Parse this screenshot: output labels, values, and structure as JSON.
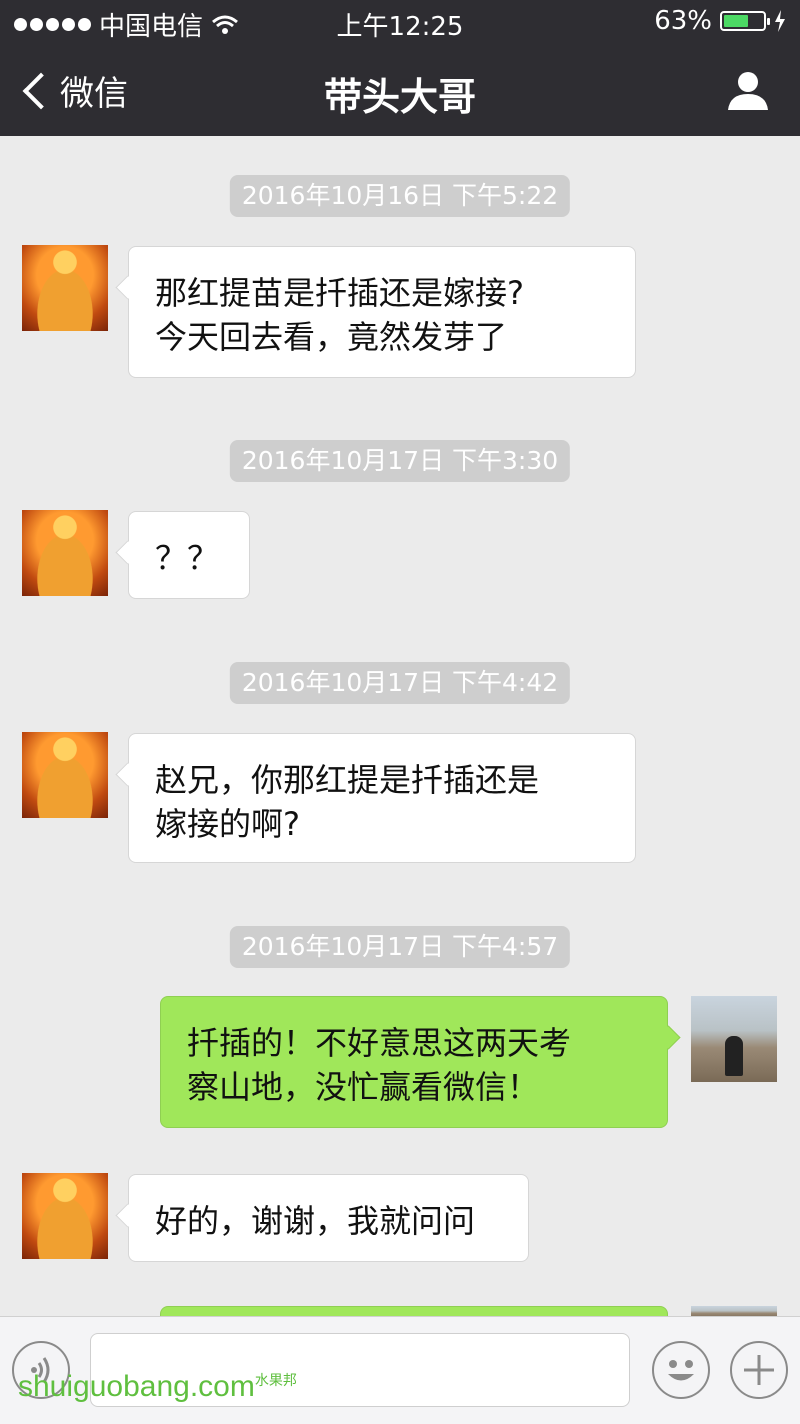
{
  "status_bar": {
    "carrier": "中国电信",
    "time": "上午12:25",
    "battery": "63%",
    "battery_level": 0.63
  },
  "nav": {
    "back_label": "微信",
    "title": "带头大哥"
  },
  "timestamps": [
    "2016年10月16日 下午5:22",
    "2016年10月17日 下午3:30",
    "2016年10月17日 下午4:42",
    "2016年10月17日 下午4:57"
  ],
  "messages": [
    {
      "from": "other",
      "lines": [
        "那红提苗是扦插还是嫁接?",
        "今天回去看，竟然发芽了"
      ]
    },
    {
      "from": "other",
      "lines": [
        "？？"
      ]
    },
    {
      "from": "other",
      "lines": [
        "赵兄，你那红提是扦插还是",
        "嫁接的啊?"
      ]
    },
    {
      "from": "me",
      "lines": [
        "扦插的！不好意思这两天考",
        "察山地，没忙赢看微信！"
      ]
    },
    {
      "from": "other",
      "lines": [
        "好的，谢谢，我就问问"
      ]
    }
  ],
  "watermark": {
    "text": "shuiguobang.com",
    "small": "水果邦"
  },
  "colors": {
    "header": "#2e2d32",
    "chat_bg": "#ebebeb",
    "my_bubble": "#a0e75a",
    "other_bubble": "#ffffff"
  }
}
